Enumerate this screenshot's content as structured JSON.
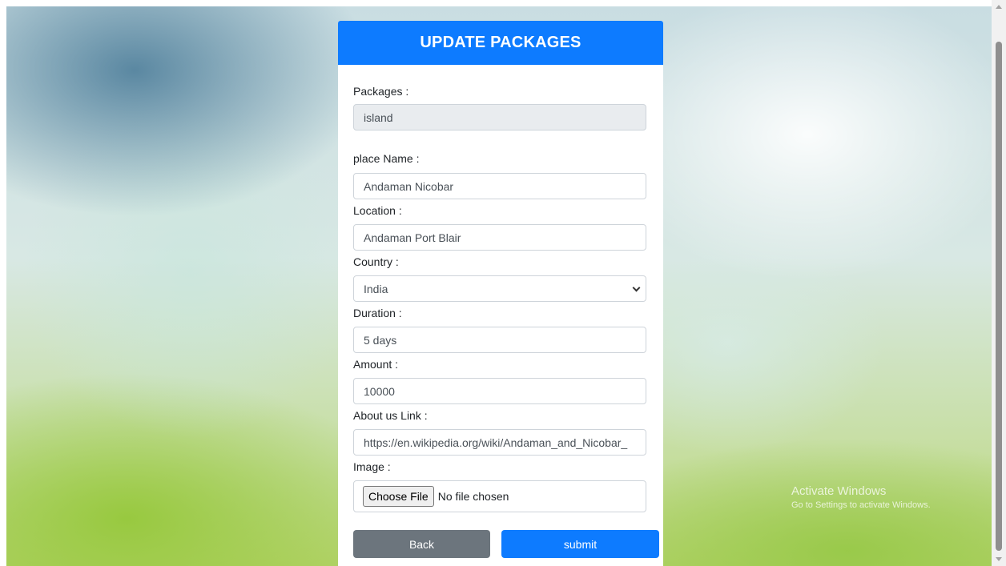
{
  "form": {
    "title": "UPDATE PACKAGES",
    "packages": {
      "label": "Packages :",
      "value": "island"
    },
    "place_name": {
      "label": "place Name :",
      "value": "Andaman Nicobar"
    },
    "location": {
      "label": "Location :",
      "value": "Andaman Port Blair"
    },
    "country": {
      "label": "Country :",
      "value": "India"
    },
    "duration": {
      "label": "Duration :",
      "value": "5 days"
    },
    "amount": {
      "label": "Amount :",
      "value": "10000"
    },
    "about_link": {
      "label": "About us Link :",
      "value": "https://en.wikipedia.org/wiki/Andaman_and_Nicobar_"
    },
    "image": {
      "label": "Image :",
      "button_label": "Choose File",
      "status": "No file chosen"
    },
    "back_label": "Back",
    "submit_label": "submit"
  },
  "watermark": {
    "title": "Activate Windows",
    "subtitle": "Go to Settings to activate Windows."
  },
  "colors": {
    "primary": "#0d7bff",
    "secondary": "#6c757d",
    "readonly_bg": "#e9ecef"
  }
}
